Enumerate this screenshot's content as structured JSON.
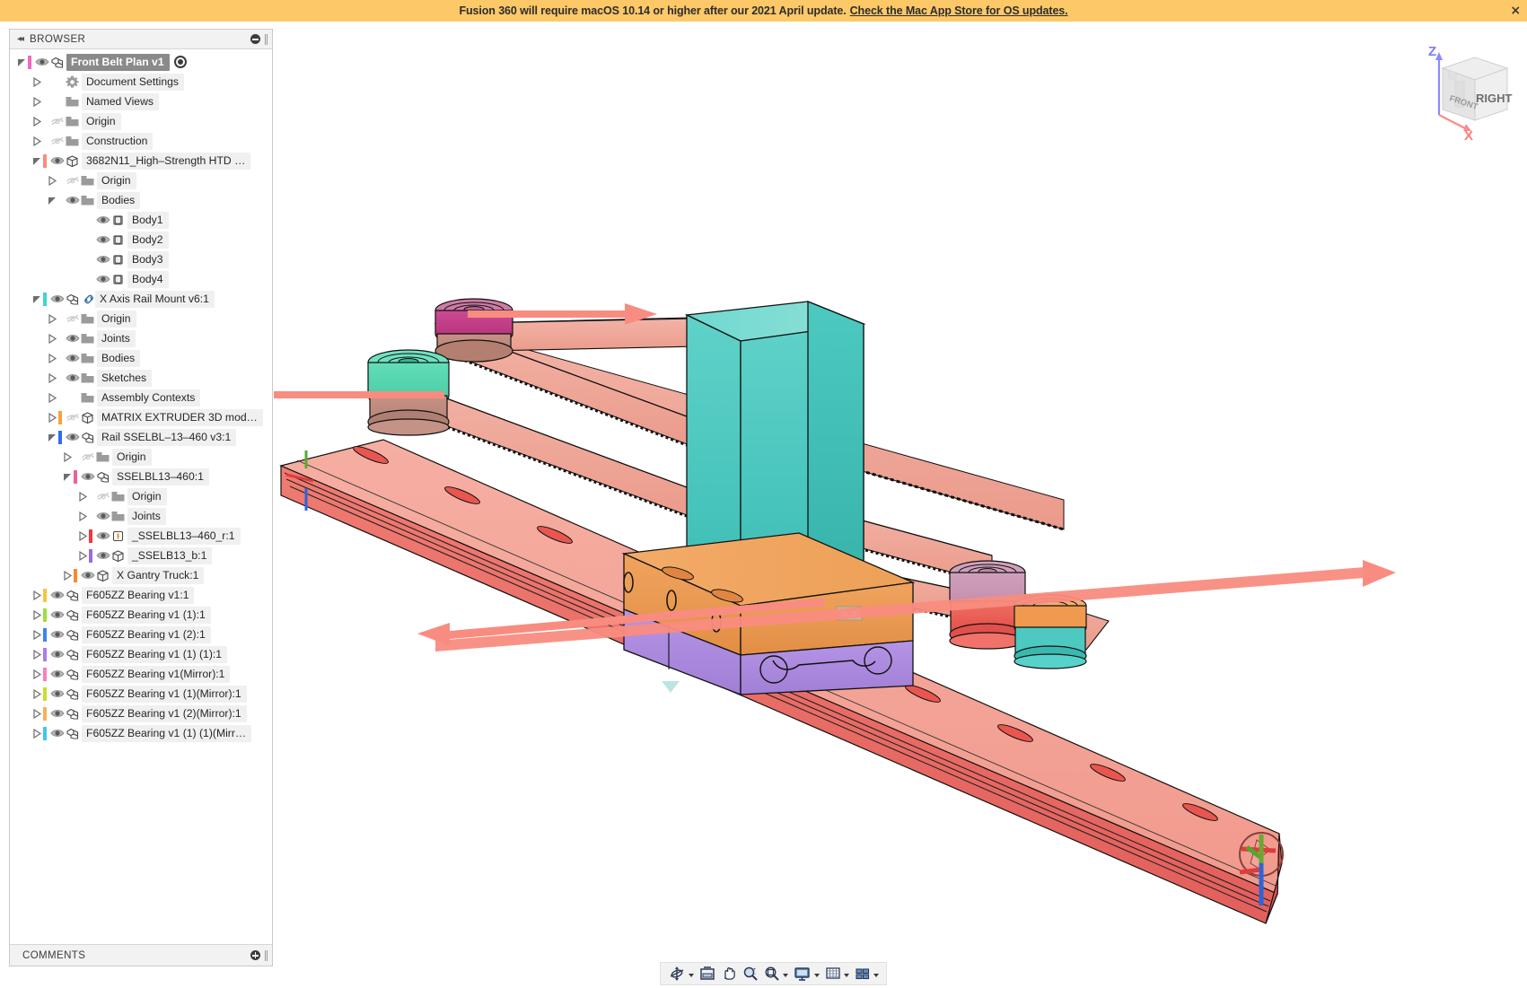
{
  "banner": {
    "message": "Fusion 360 will require macOS 10.14 or higher after our 2021 April update.",
    "link_text": "Check the Mac App Store for OS updates.",
    "close_label": "×",
    "background": "#fcc868"
  },
  "browser": {
    "title": "BROWSER",
    "collapse_label": "◂◂",
    "tree": [
      {
        "label": "Front Belt Plan v1",
        "indent": 0,
        "arrow": "open",
        "color": "#f06ac0",
        "eye": "on",
        "icon": "component-icon",
        "selected": true,
        "radio": true
      },
      {
        "label": "Document Settings",
        "indent": 1,
        "arrow": "closed",
        "color": "none",
        "eye": "none",
        "icon": "gear-icon"
      },
      {
        "label": "Named Views",
        "indent": 1,
        "arrow": "closed",
        "color": "none",
        "eye": "none",
        "icon": "folder-icon"
      },
      {
        "label": "Origin",
        "indent": 1,
        "arrow": "closed",
        "color": "none",
        "eye": "off",
        "icon": "folder-icon"
      },
      {
        "label": "Construction",
        "indent": 1,
        "arrow": "closed",
        "color": "none",
        "eye": "off",
        "icon": "folder-icon"
      },
      {
        "label": "3682N11_High–Strength HTD …",
        "indent": 1,
        "arrow": "open",
        "color": "#f98b7f",
        "eye": "on",
        "icon": "body-icon"
      },
      {
        "label": "Origin",
        "indent": 2,
        "arrow": "closed",
        "color": "none",
        "eye": "off",
        "icon": "folder-icon"
      },
      {
        "label": "Bodies",
        "indent": 2,
        "arrow": "open",
        "color": "none",
        "eye": "on",
        "icon": "folder-icon"
      },
      {
        "label": "Body1",
        "indent": 4,
        "arrow": "none",
        "color": "none",
        "eye": "on",
        "icon": "cylinder-icon"
      },
      {
        "label": "Body2",
        "indent": 4,
        "arrow": "none",
        "color": "none",
        "eye": "on",
        "icon": "cylinder-icon"
      },
      {
        "label": "Body3",
        "indent": 4,
        "arrow": "none",
        "color": "none",
        "eye": "on",
        "icon": "cylinder-icon"
      },
      {
        "label": "Body4",
        "indent": 4,
        "arrow": "none",
        "color": "none",
        "eye": "on",
        "icon": "cylinder-icon"
      },
      {
        "label": "X Axis Rail Mount v6:1",
        "indent": 1,
        "arrow": "open",
        "color": "#3fd6cd",
        "eye": "on",
        "icon": "component-icon",
        "link": true
      },
      {
        "label": "Origin",
        "indent": 2,
        "arrow": "closed",
        "color": "none",
        "eye": "off",
        "icon": "folder-icon"
      },
      {
        "label": "Joints",
        "indent": 2,
        "arrow": "closed",
        "color": "none",
        "eye": "on",
        "icon": "folder-icon"
      },
      {
        "label": "Bodies",
        "indent": 2,
        "arrow": "closed",
        "color": "none",
        "eye": "on",
        "icon": "folder-icon"
      },
      {
        "label": "Sketches",
        "indent": 2,
        "arrow": "closed",
        "color": "none",
        "eye": "on",
        "icon": "folder-icon"
      },
      {
        "label": "Assembly Contexts",
        "indent": 2,
        "arrow": "closed",
        "color": "none",
        "eye": "none",
        "icon": "folder-icon"
      },
      {
        "label": "MATRIX EXTRUDER 3D mod…",
        "indent": 2,
        "arrow": "closed",
        "color": "#f8a13f",
        "eye": "off",
        "icon": "body-icon"
      },
      {
        "label": "Rail SSELBL–13–460 v3:1",
        "indent": 2,
        "arrow": "open",
        "color": "#2e6cf0",
        "eye": "on",
        "icon": "component-icon"
      },
      {
        "label": "Origin",
        "indent": 3,
        "arrow": "closed",
        "color": "none",
        "eye": "off",
        "icon": "folder-icon"
      },
      {
        "label": "SSELBL13–460:1",
        "indent": 3,
        "arrow": "open",
        "color": "#f0609f",
        "eye": "on",
        "icon": "component-icon"
      },
      {
        "label": "Origin",
        "indent": 4,
        "arrow": "closed",
        "color": "none",
        "eye": "off",
        "icon": "folder-icon"
      },
      {
        "label": "Joints",
        "indent": 4,
        "arrow": "closed",
        "color": "none",
        "eye": "on",
        "icon": "folder-icon"
      },
      {
        "label": "_SSELBL13–460_r:1",
        "indent": 4,
        "arrow": "closed",
        "color": "#f2383d",
        "eye": "on",
        "icon": "body-pinned-icon"
      },
      {
        "label": "_SSELB13_b:1",
        "indent": 4,
        "arrow": "closed",
        "color": "#9b6be0",
        "eye": "on",
        "icon": "body-icon"
      },
      {
        "label": "X Gantry Truck:1",
        "indent": 3,
        "arrow": "closed",
        "color": "#f8892f",
        "eye": "on",
        "icon": "body-icon"
      },
      {
        "label": "F605ZZ Bearing v1:1",
        "indent": 1,
        "arrow": "closed",
        "color": "#f5c542",
        "eye": "on",
        "icon": "component-icon"
      },
      {
        "label": "F605ZZ Bearing v1 (1):1",
        "indent": 1,
        "arrow": "closed",
        "color": "#9ede3a",
        "eye": "on",
        "icon": "component-icon"
      },
      {
        "label": "F605ZZ Bearing v1 (2):1",
        "indent": 1,
        "arrow": "closed",
        "color": "#3d83f0",
        "eye": "on",
        "icon": "component-icon"
      },
      {
        "label": "F605ZZ Bearing v1 (1) (1):1",
        "indent": 1,
        "arrow": "closed",
        "color": "#ab7bf0",
        "eye": "on",
        "icon": "component-icon"
      },
      {
        "label": "F605ZZ Bearing v1(Mirror):1",
        "indent": 1,
        "arrow": "closed",
        "color": "#fa7fb8",
        "eye": "on",
        "icon": "component-icon"
      },
      {
        "label": "F605ZZ Bearing v1 (1)(Mirror):1",
        "indent": 1,
        "arrow": "closed",
        "color": "#ccdd2a",
        "eye": "on",
        "icon": "component-icon"
      },
      {
        "label": "F605ZZ Bearing v1 (2)(Mirror):1",
        "indent": 1,
        "arrow": "closed",
        "color": "#f8b05a",
        "eye": "on",
        "icon": "component-icon"
      },
      {
        "label": "F605ZZ Bearing v1 (1) (1)(Mirr…",
        "indent": 1,
        "arrow": "closed",
        "color": "#3ec6f0",
        "eye": "on",
        "icon": "component-icon"
      }
    ]
  },
  "comments": {
    "title": "COMMENTS"
  },
  "viewcube": {
    "face_front": "RIGHT",
    "face_side": "FRONT",
    "axis_z": "Z",
    "axis_x": "X"
  },
  "toolbar": {
    "items": [
      {
        "name": "orbit-icon",
        "caret": true
      },
      {
        "name": "look-at-icon",
        "caret": false
      },
      {
        "name": "pan-icon",
        "caret": false
      },
      {
        "name": "zoom-icon",
        "caret": false
      },
      {
        "name": "zoom-window-icon",
        "caret": true
      },
      {
        "name": "display-settings-icon",
        "caret": true
      },
      {
        "name": "grid-snap-icon",
        "caret": true
      },
      {
        "name": "viewports-icon",
        "caret": true
      }
    ]
  },
  "canvas": {
    "model_name": "Front Belt Plan",
    "colors": {
      "belt": "#f0a79a",
      "rail_top": "#f3a094",
      "rail_side": "#ef6b6b",
      "plate_teal": "#4ec9c1",
      "truck_orange": "#ef9a52",
      "block_purple": "#ae8ce0",
      "pulley_magenta": "#c0357f",
      "pulley_green": "#52d6ad",
      "pulley_mauve": "#c08aa8",
      "pulley_red": "#e8544e",
      "arrow": "#f98c80"
    },
    "arrows": [
      {
        "name": "arrow-top-right",
        "direction": "right"
      },
      {
        "name": "arrow-top-left",
        "direction": "left"
      },
      {
        "name": "arrow-bottom-right",
        "direction": "right"
      },
      {
        "name": "arrow-bottom-left",
        "direction": "left"
      }
    ]
  }
}
